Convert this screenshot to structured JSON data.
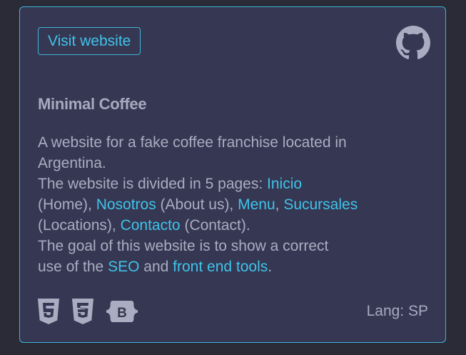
{
  "card": {
    "visit_label": "Visit website",
    "title": "Minimal Coffee",
    "description": {
      "line1": "A website for a fake coffee franchise located in",
      "line2": "Argentina.",
      "line3_prefix": "The website is divided in 5 pages: ",
      "link_inicio": "Inicio",
      "text_home": "(Home), ",
      "link_nosotros": "Nosotros",
      "text_about": " (About us), ",
      "link_menu": "Menu",
      "comma": ", ",
      "link_sucursales": "Sucursales",
      "text_locations": "(Locations), ",
      "link_contacto": "Contacto",
      "text_contact": " (Contact).",
      "line7": "The goal of this website is to show a correct",
      "line8_prefix": "use of the ",
      "link_seo": "SEO",
      "text_and": " and ",
      "link_tools": "front end tools",
      "period": "."
    },
    "tech_icons": [
      "html5-icon",
      "css3-icon",
      "bootstrap-icon"
    ],
    "lang": "Lang: SP"
  },
  "colors": {
    "background": "#2a2b36",
    "card": "#363752",
    "accent": "#3fc3ea",
    "text": "#a9adc2"
  }
}
